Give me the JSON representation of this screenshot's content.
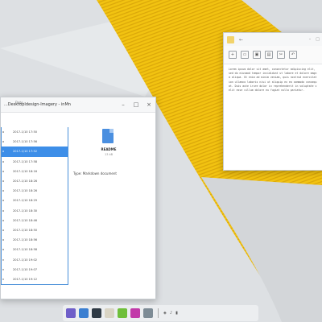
{
  "file_manager": {
    "title": "...DesktopIdesign-Imagery - inMn",
    "column_header": "Date",
    "rows": [
      {
        "name": "o",
        "date": "2017-1/10 17:50"
      },
      {
        "name": "o",
        "date": "2017-1/10 17:56"
      },
      {
        "name": "o",
        "date": "2017-1/10 17:52"
      },
      {
        "name": "o",
        "date": "2017-1/10 17:58"
      },
      {
        "name": "o",
        "date": "2017-1/10 18:16"
      },
      {
        "name": "o",
        "date": "2017-1/10 18:26"
      },
      {
        "name": "o",
        "date": "2017-1/10 18:26"
      },
      {
        "name": "o",
        "date": "2017-1/10 18:29"
      },
      {
        "name": "o",
        "date": "2017-1/10 18:30"
      },
      {
        "name": "o",
        "date": "2017-1/10 18:46"
      },
      {
        "name": "o",
        "date": "2017-1/10 18:50"
      },
      {
        "name": "o",
        "date": "2017-1/10 18:56"
      },
      {
        "name": "o",
        "date": "2017-1/10 18:58"
      },
      {
        "name": "n",
        "date": "2017-1/10 19:02"
      },
      {
        "name": "n",
        "date": "2017-1/10 19:07"
      },
      {
        "name": "n",
        "date": "2017-1/10 19:12"
      }
    ],
    "selected_row_index": 2,
    "preview": {
      "file_name": "README",
      "file_size": "13 kB",
      "type_label": "Type:  Markdown document"
    }
  },
  "editor": {
    "title": "",
    "toolbar_icons": [
      "new-file-icon",
      "open-icon",
      "save-icon",
      "print-icon",
      "cut-icon",
      "undo-icon"
    ],
    "text": "Lorem ipsum dolor sit amet, consectetur adipiscing elit, sed do eiusmod tempor incididunt ut labore et dolore magna aliqua. Ut enim ad minim veniam, quis nostrud exercitation ullamco laboris nisi ut aliquip ex ea commodo consequat. Duis aute irure dolor in reprehenderit in voluptate velit esse cillum dolore eu fugiat nulla pariatur."
  },
  "taskbar": {
    "apps": [
      {
        "icon": "launcher-icon",
        "color": "#6f5fc9"
      },
      {
        "icon": "files-icon",
        "color": "#3b7fd1"
      },
      {
        "icon": "terminal-icon",
        "color": "#2f3a45"
      },
      {
        "icon": "text-editor-icon",
        "color": "#d9d4c4"
      },
      {
        "icon": "store-icon",
        "color": "#6fbf3a"
      },
      {
        "icon": "music-icon",
        "color": "#c23aa9"
      },
      {
        "icon": "settings-icon",
        "color": "#7d8b95"
      }
    ]
  },
  "colors": {
    "wallpaper_yellow": "#f1c40f",
    "selection_blue": "#3d8ee8"
  }
}
